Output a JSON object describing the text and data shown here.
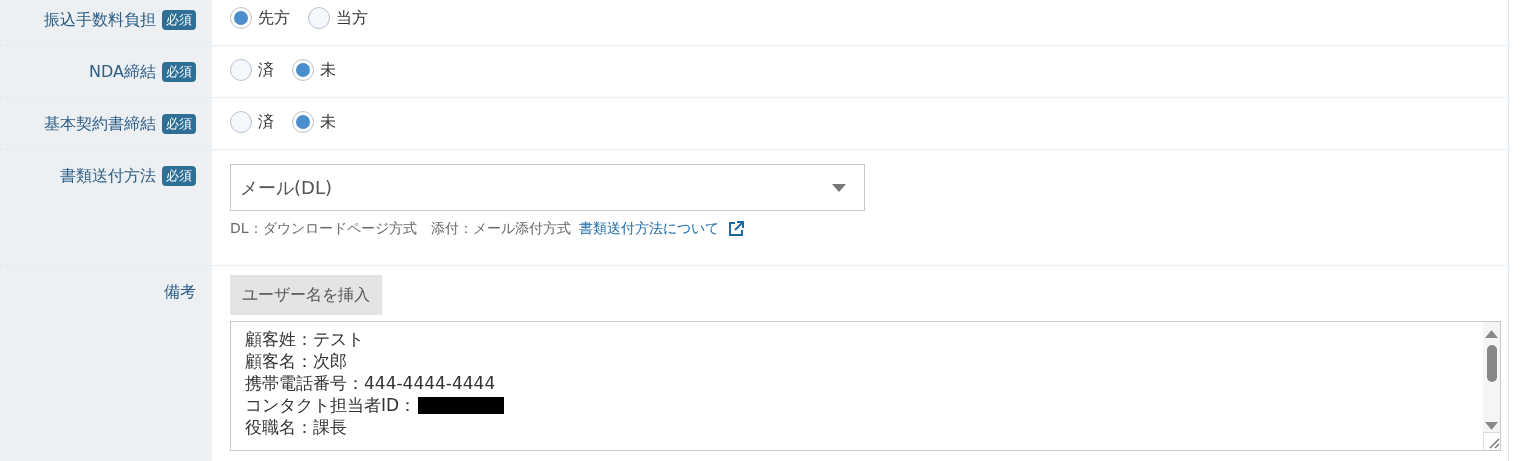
{
  "fields": [
    {
      "kind": "radio",
      "label": "振込手数料負担",
      "required_badge": "必須",
      "options": [
        {
          "label": "先方",
          "selected": true
        },
        {
          "label": "当方",
          "selected": false
        }
      ]
    },
    {
      "kind": "radio",
      "label": "NDA締結",
      "required_badge": "必須",
      "options": [
        {
          "label": "済",
          "selected": false
        },
        {
          "label": "未",
          "selected": true
        }
      ]
    },
    {
      "kind": "radio",
      "label": "基本契約書締結",
      "required_badge": "必須",
      "options": [
        {
          "label": "済",
          "selected": false
        },
        {
          "label": "未",
          "selected": true
        }
      ]
    },
    {
      "kind": "select",
      "label": "書類送付方法",
      "required_badge": "必須",
      "value": "メール(DL)",
      "help": "DL：ダウンロードページ方式　添付：メール添付方式",
      "help_link": "書類送付方法について"
    },
    {
      "kind": "textarea",
      "label": "備考",
      "button": "ユーザー名を挿入",
      "lines": [
        {
          "text": "顧客姓：テスト"
        },
        {
          "text": "顧客名：次郎"
        },
        {
          "text": "携帯電話番号：444-4444-4444"
        },
        {
          "text": "コンタクト担当者ID：",
          "redacted": true
        },
        {
          "text": "役職名：課長"
        }
      ]
    }
  ]
}
